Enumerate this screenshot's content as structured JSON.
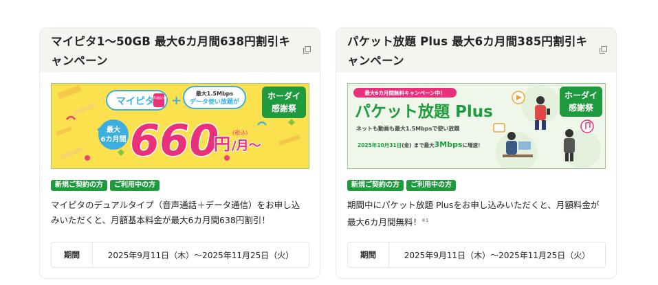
{
  "cards": [
    {
      "title_line1": "マイピタ1～50GB 最大6カ月間638円割引キ",
      "title_line2": "ャンペーン",
      "tags": [
        "新規ご契約の方",
        "ご利用中の方"
      ],
      "desc_line1": "マイピタのデュアルタイプ（音声通話＋データ通信）をお申し込",
      "desc_line2": "みいただくと、月額基本料金が最大6カ月間638円割引！",
      "period_label": "期間",
      "period_value": "2025年9月11日（木）～2025年11月25日（火）",
      "banner": {
        "brand": "マイピタ",
        "brand_sub": "音声通話付き",
        "plus": "+",
        "speed_line1": "最大1.5Mbps",
        "speed_line2": "データ使い放題が",
        "badge_line1": "最大",
        "badge_line2": "6カ月間",
        "price": "660",
        "price_unit": "円",
        "price_tax": "(税込)",
        "price_month": "/月～",
        "logo_line1": "ホーダイ",
        "logo_line2": "感謝祭"
      }
    },
    {
      "title_line1": "パケット放題 Plus 最大6カ月間385円割引キ",
      "title_line2": "ャンペーン",
      "tags": [
        "新規ご契約の方",
        "ご利用中の方"
      ],
      "desc_line1": "期間中にパケット放題 Plusをお申し込みいただくと、月額料金が",
      "desc_line2": "最大6カ月間無料！",
      "desc_note": "※1",
      "period_label": "期間",
      "period_value": "2025年9月11日（木）～2025年11月25日（火）",
      "banner": {
        "ribbon": "最大6カ月間無料キャンペーン中！",
        "headline": "パケット放題 Plus",
        "sub": "ネットも動画も最大1.5Mbpsで使い放題",
        "date_note_a": "2025年10月31日",
        "date_note_b": "(金)",
        "date_note_c": "まで最大",
        "date_note_d": "3Mbps",
        "date_note_e": "に増速！",
        "logo_line1": "ホーダイ",
        "logo_line2": "感謝祭"
      }
    }
  ],
  "colors": {
    "accent_green": "#1f9a3e",
    "pink": "#e8317a",
    "yellow": "#fbe14d",
    "header_bg": "#f2f5f0"
  },
  "icons": [
    "external-link-icon"
  ]
}
